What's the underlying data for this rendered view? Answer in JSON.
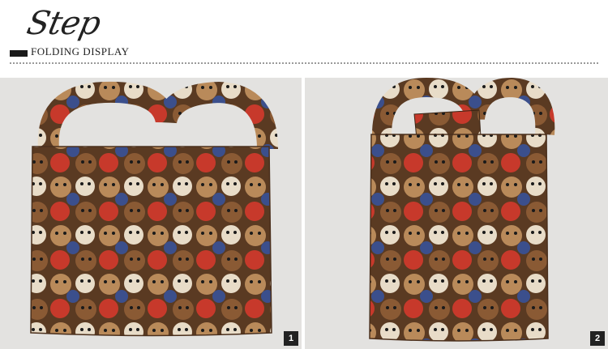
{
  "header": {
    "script_title": "Step",
    "subtitle": "FOLDING DISPLAY"
  },
  "panels": [
    {
      "badge": "1"
    },
    {
      "badge": "2"
    }
  ],
  "colors": {
    "background": "#e3e2e0",
    "text": "#222222",
    "badge_bg": "#222222",
    "badge_fg": "#ffffff"
  }
}
